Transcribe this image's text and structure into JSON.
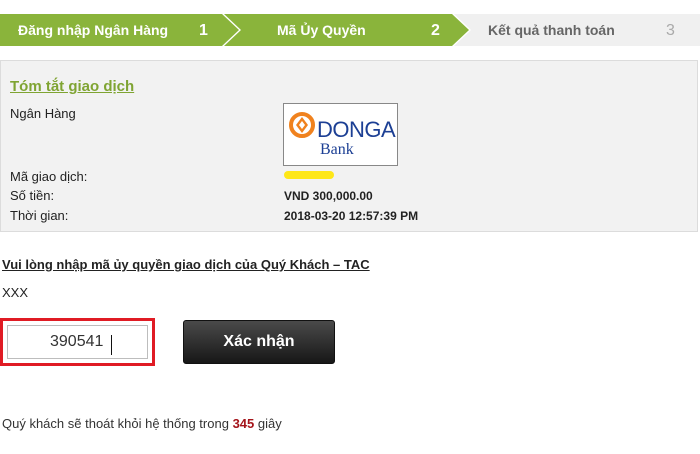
{
  "steps": [
    {
      "label": "Đăng nhập Ngân Hàng",
      "number": "1",
      "state": "done"
    },
    {
      "label": "Mã Ủy Quyền",
      "number": "2",
      "state": "active"
    },
    {
      "label": "Kết quả thanh toán",
      "number": "3",
      "state": "pending"
    }
  ],
  "colors": {
    "step_active": "#8ab43b",
    "step_inactive": "#f0f0f0",
    "title_green": "#7fa432",
    "input_highlight": "#e01b24",
    "countdown": "#a4141a",
    "bank_blue": "#1c3f94",
    "bank_orange": "#f0821e"
  },
  "summary": {
    "title": "Tóm tắt giao dịch",
    "bank_label": "Ngân Hàng",
    "bank_logo": {
      "word1": "DONGA",
      "word2": "Bank",
      "icon": "donga-bank-logo-icon"
    },
    "transaction_id_label": "Mã giao dịch:",
    "amount_label": "Số tiền:",
    "amount_value": "VND 300,000.00",
    "time_label": "Thời gian:",
    "time_value": "2018-03-20 12:57:39 PM"
  },
  "tac": {
    "heading": "Vui lòng nhập mã ủy quyền giao dịch của Quý Khách – TAC",
    "code_label": "XXX",
    "input_value": "390541",
    "confirm_label": "Xác nhận"
  },
  "timer": {
    "prefix": "Quý khách sẽ thoát khỏi hệ thống trong",
    "seconds": "345",
    "suffix": "giây"
  }
}
